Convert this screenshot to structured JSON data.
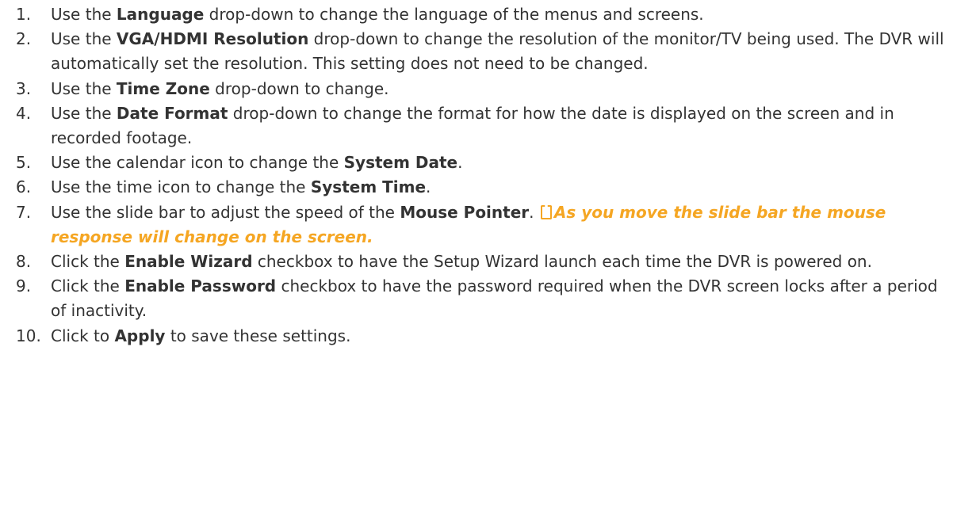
{
  "steps": [
    {
      "number": "1.",
      "before": "Use the ",
      "bold": "Language",
      "after": " drop-down to change the language of the menus and screens."
    },
    {
      "number": "2.",
      "before": "Use the ",
      "bold": "VGA/HDMI Resolution",
      "after": " drop-down to change the resolution of the monitor/TV being used. The DVR will automatically set the resolution. This setting does not need to be changed."
    },
    {
      "number": "3.",
      "before": "Use the ",
      "bold": "Time Zone",
      "after": " drop-down to change."
    },
    {
      "number": "4.",
      "before": "Use the ",
      "bold": "Date Format",
      "after": " drop-down to change the format for how the date is displayed on the screen and in recorded footage."
    },
    {
      "number": "5.",
      "before": "Use the calendar icon to change the ",
      "bold": "System Date",
      "after": "."
    },
    {
      "number": "6.",
      "before": "Use the time icon to change the ",
      "bold": "System Time",
      "after": "."
    },
    {
      "number": "7.",
      "before": "Use the slide bar to adjust the speed of the ",
      "bold": "Mouse Pointer",
      "after": ". ",
      "note": "As you move the slide bar the mouse response will change on the screen.",
      "note_icon": "note-icon"
    },
    {
      "number": "8.",
      "before": "Click the ",
      "bold": "Enable Wizard",
      "after": " checkbox to have the Setup Wizard launch each time the DVR is powered on."
    },
    {
      "number": "9.",
      "before": "Click the ",
      "bold": "Enable Password",
      "after": " checkbox to have the password required when the DVR screen locks after a period of inactivity."
    },
    {
      "number": "10.",
      "before": "Click to ",
      "bold": "Apply",
      "after": " to save these settings."
    }
  ],
  "colors": {
    "text": "#333333",
    "note": "#f5a623"
  }
}
